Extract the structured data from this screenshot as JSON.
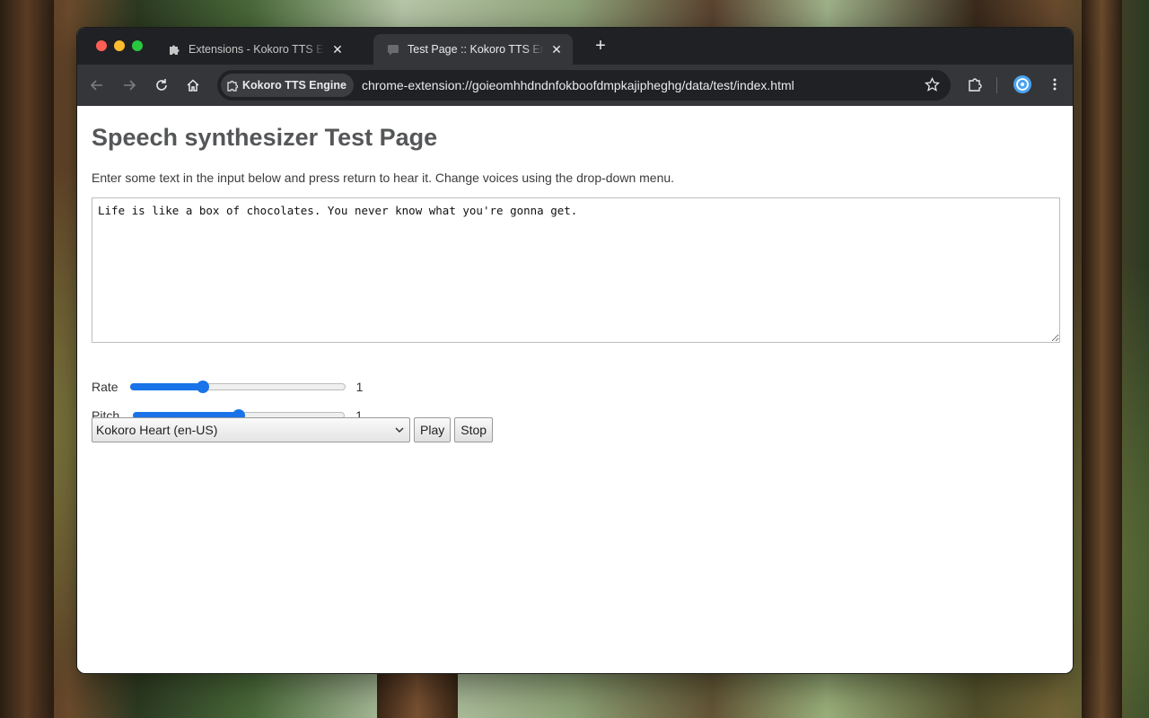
{
  "browser": {
    "tabs": [
      {
        "title": "Extensions - Kokoro TTS Engine",
        "icon": "puzzle-icon",
        "active": false
      },
      {
        "title": "Test Page :: Kokoro TTS Engine",
        "icon": "message-icon",
        "active": true
      }
    ],
    "site_chip": "Kokoro TTS Engine",
    "url": "chrome-extension://goieomhhdndnfokboofdmpkajipheghg/data/test/index.html"
  },
  "page": {
    "title": "Speech synthesizer Test Page",
    "description": "Enter some text in the input below and press return to hear it. Change voices using the drop-down menu.",
    "text_input": "Life is like a box of chocolates. You never know what you're gonna get.",
    "rate": {
      "label": "Rate",
      "value": "1",
      "position": 0.34
    },
    "pitch": {
      "label": "Pitch",
      "value": "1",
      "position": 0.5
    },
    "voice": "Kokoro Heart (en-US)",
    "play_label": "Play",
    "stop_label": "Stop"
  },
  "colors": {
    "accent": "#1a73e8",
    "tabstrip": "#202124",
    "toolbar": "#35363a",
    "heading": "#555658"
  }
}
